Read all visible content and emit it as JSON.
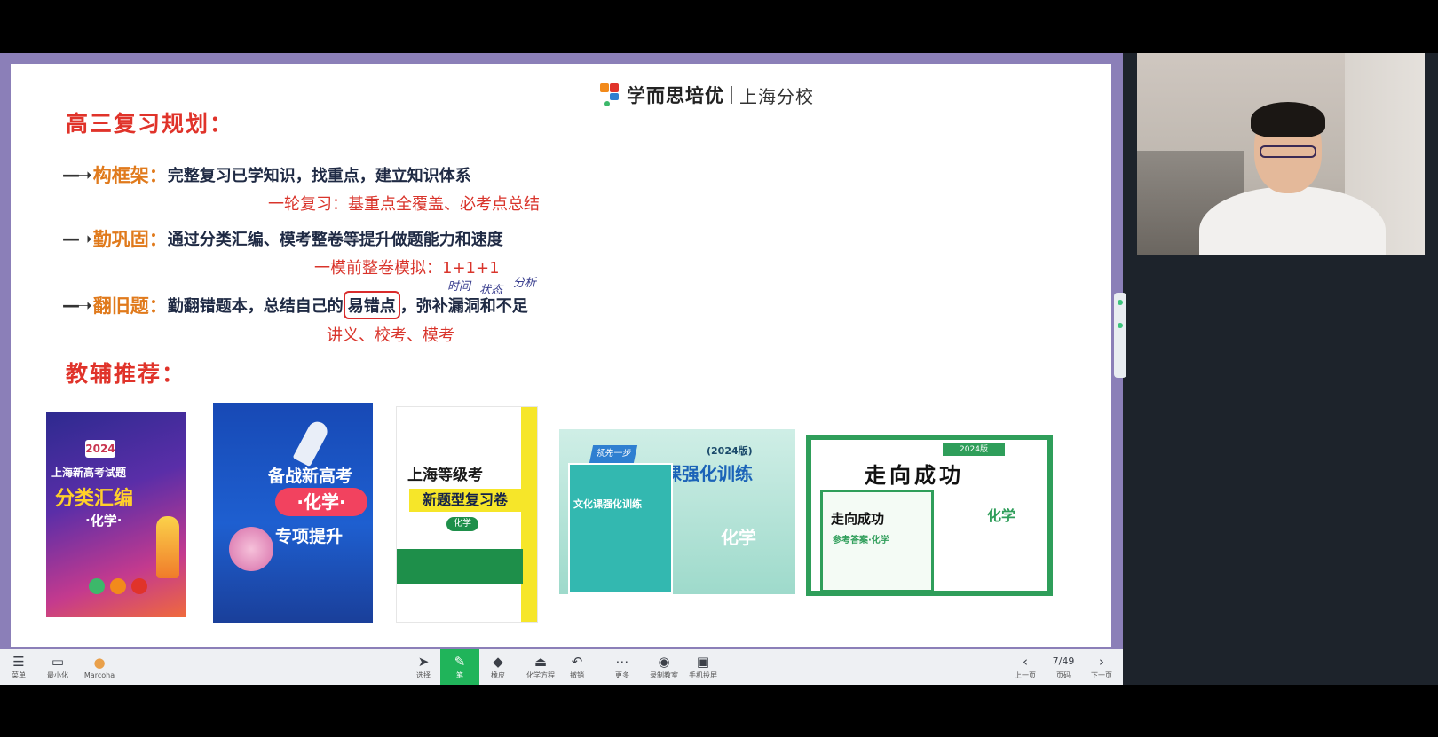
{
  "brand": {
    "name": "学而思培优",
    "branch": "上海分校"
  },
  "slide": {
    "title": "高三复习规划：",
    "rows": [
      {
        "label": "构框架：",
        "text": "完整复习已学知识，找重点，建立知识体系",
        "note": "一轮复习：基重点全覆盖、必考点总结"
      },
      {
        "label": "勤巩固：",
        "text": "通过分类汇编、模考整卷等提升做题能力和速度",
        "note": "一模前整卷模拟：1+1+1"
      },
      {
        "label": "翻旧题：",
        "text_before": "勤翻错题本，总结自己的",
        "highlight": "易错点",
        "text_after": "，弥补漏洞和不足",
        "note": "讲义、校考、模考"
      }
    ],
    "handwriting": {
      "a": "时间",
      "b": "状态",
      "c": "分析"
    },
    "section_title": "教辅推荐："
  },
  "books": {
    "b1": {
      "year": "2024",
      "line1": "上海新高考试题",
      "line2": "分类汇编",
      "subject": "·化学·"
    },
    "b2": {
      "line1": "备战新高考",
      "subject": "·化学·",
      "line2": "专项提升"
    },
    "b3": {
      "line1": "上海等级考",
      "line2": "新题型复习卷",
      "subject": "化学"
    },
    "b4": {
      "edition": "(2024版)",
      "line1": "课强化训练",
      "subject": "化学",
      "badge": "领先一步",
      "inner_title": "文化课强化训练"
    },
    "b5": {
      "edition": "2024版",
      "line1": "走向成功",
      "subject": "化学",
      "inner_title": "走向成功",
      "inner_sub": "参考答案·化学"
    }
  },
  "toolbar": {
    "left": [
      {
        "name": "menu",
        "icon": "☰",
        "label": "菜单"
      },
      {
        "name": "minimize",
        "icon": "▭",
        "label": "最小化"
      },
      {
        "name": "user",
        "icon": "●",
        "label": "Marcoha"
      }
    ],
    "center": [
      {
        "name": "select",
        "icon": "➤",
        "label": "选择"
      },
      {
        "name": "pen",
        "icon": "✎",
        "label": "笔"
      },
      {
        "name": "eraser",
        "icon": "◆",
        "label": "橡皮"
      },
      {
        "name": "equation",
        "icon": "⏏",
        "label": "化学方程"
      },
      {
        "name": "undo",
        "icon": "↶",
        "label": "撤销"
      },
      {
        "name": "more",
        "icon": "⋯",
        "label": "更多"
      },
      {
        "name": "record",
        "icon": "◉",
        "label": "录制教室"
      },
      {
        "name": "phone-cast",
        "icon": "▣",
        "label": "手机投屏"
      }
    ],
    "pager": {
      "prev": "上一页",
      "current": "7/49",
      "page_label": "页码",
      "next": "下一页"
    }
  }
}
